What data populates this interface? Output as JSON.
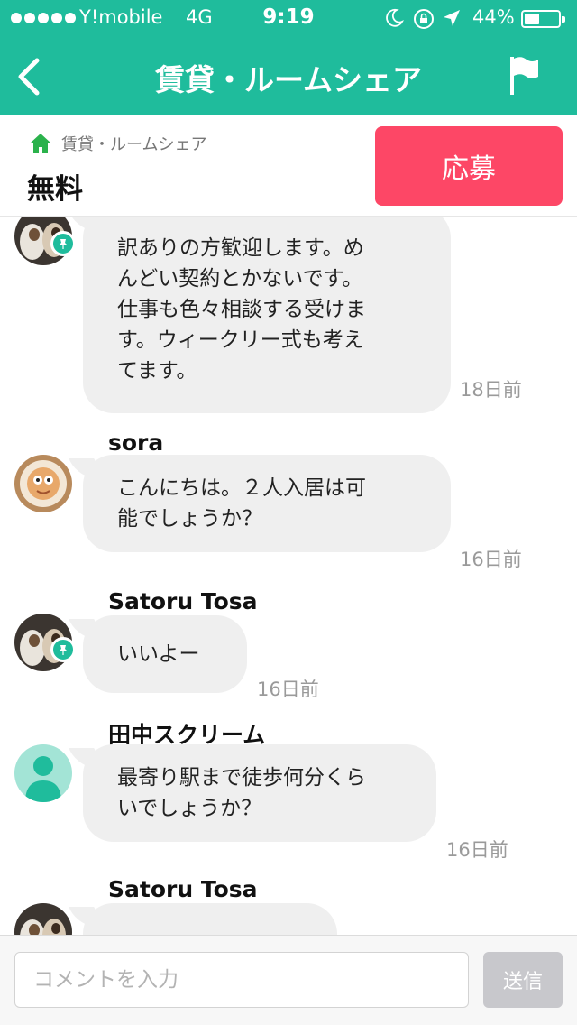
{
  "status_bar": {
    "carrier": "Y!mobile",
    "network": "4G",
    "time": "9:19",
    "battery_percent": "44%",
    "battery_level": 0.44,
    "icons": [
      "signal-dots-icon",
      "moon-icon",
      "rotation-lock-icon",
      "location-arrow-icon",
      "battery-icon"
    ]
  },
  "header": {
    "title": "賃貸・ルームシェア",
    "back_icon": "chevron-left-icon",
    "flag_icon": "flag-icon",
    "background": "#1fbc9c"
  },
  "post": {
    "breadcrumb": "賃貸・ルームシェア",
    "breadcrumb_icon": "home-icon",
    "price": "無料",
    "apply_label": "応募",
    "apply_color": "#fd4766"
  },
  "messages": [
    {
      "sender": "",
      "text": "訳ありの方歓迎します。め\nんどい契約とかないです。\n仕事も色々相談する受けま\nす。ウィークリー式も考え\nてます。",
      "time": "18日前",
      "avatar": "cats-photo",
      "owner_badge": true
    },
    {
      "sender": "sora",
      "text": "こんにちは。２人入居は可\n能でしょうか？",
      "time": "16日前",
      "avatar": "latte-art-photo",
      "owner_badge": false
    },
    {
      "sender": "Satoru Tosa",
      "text": "いいよー",
      "time": "16日前",
      "avatar": "cats-photo",
      "owner_badge": true
    },
    {
      "sender": "田中スクリーム",
      "text": "最寄り駅まで徒歩何分くら\nいでしょうか？",
      "time": "16日前",
      "avatar": "default-user",
      "owner_badge": false
    },
    {
      "sender": "Satoru Tosa",
      "text": "",
      "time": "",
      "avatar": "cats-photo",
      "owner_badge": true
    }
  ],
  "composer": {
    "placeholder": "コメントを入力",
    "value": "",
    "send_label": "送信"
  }
}
